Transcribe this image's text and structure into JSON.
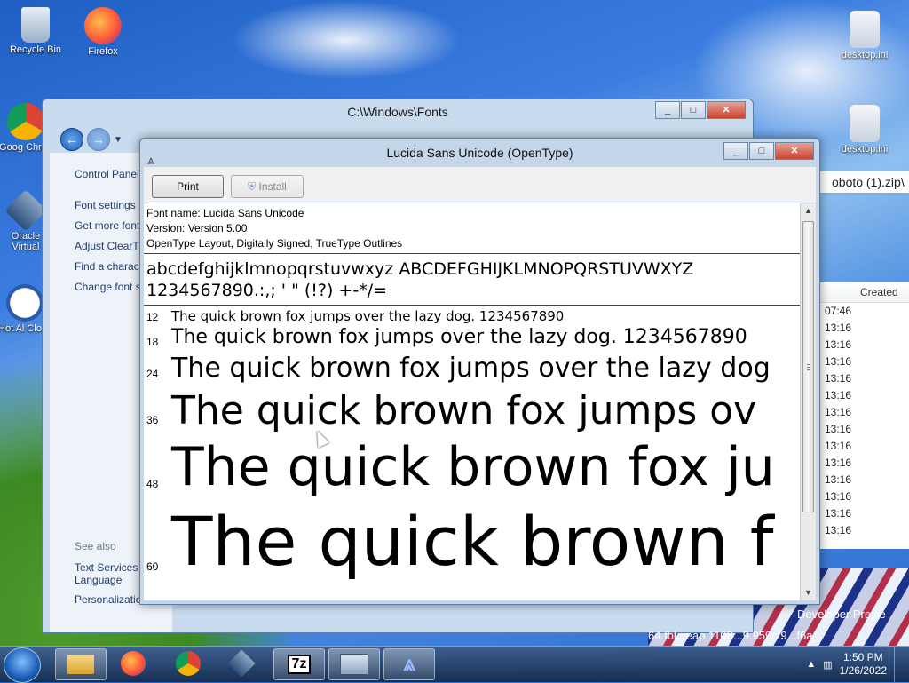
{
  "desktop": {
    "icons_left": [
      {
        "label": "Recycle Bin",
        "icon": "recycle-bin-icon"
      },
      {
        "label": "Firefox",
        "icon": "firefox-icon"
      },
      {
        "label": "Goog Chron",
        "icon": "chrome-icon"
      },
      {
        "label": "Oracle Virtual",
        "icon": "virtualbox-icon"
      },
      {
        "label": "Hot Al Clock",
        "icon": "clock-icon"
      }
    ],
    "icons_right": [
      {
        "label": "desktop.ini",
        "icon": "settings-file-icon"
      },
      {
        "label": "desktop.ini",
        "icon": "settings-file-icon"
      }
    ]
  },
  "explorer": {
    "title": "C:\\Windows\\Fonts",
    "left_links": [
      "Control Panel",
      "Font settings",
      "Get more font online",
      "Adjust ClearT",
      "Find a characte",
      "Change font s"
    ],
    "see_also_label": "See also",
    "see_also_links": [
      "Text Services Language",
      "Personalizatio"
    ],
    "address_right": "oboto (1).zip\\",
    "column_header": "Created",
    "created_times": [
      "07:46",
      "13:16",
      "13:16",
      "13:16",
      "13:16",
      "13:16",
      "13:16",
      "13:16",
      "13:16",
      "13:16",
      "13:16",
      "13:16",
      "13:16",
      "13:16"
    ],
    "status_lines": [
      "Developer Previe",
      "64.fbl...eap.1108...9.959cf9...f6a"
    ],
    "hidden_button": "Flag"
  },
  "font_viewer": {
    "title": "Lucida Sans Unicode (OpenType)",
    "print_button": "Print",
    "install_button": "Install",
    "font_name_line": "Font name: Lucida Sans Unicode",
    "version_line": "Version: Version 5.00",
    "features_line": "OpenType Layout, Digitally Signed, TrueType Outlines",
    "charset_line1": "abcdefghijklmnopqrstuvwxyz ABCDEFGHIJKLMNOPQRSTUVWXYZ",
    "charset_line2": "1234567890.:,; ' \" (!?) +-*/=",
    "samples": [
      {
        "size": "12",
        "text": "The quick brown fox jumps over the lazy dog. 1234567890"
      },
      {
        "size": "18",
        "text": "The quick brown fox jumps over the lazy dog. 1234567890"
      },
      {
        "size": "24",
        "text": "The quick brown fox jumps over the lazy dog"
      },
      {
        "size": "36",
        "text": "The quick brown fox jumps ov"
      },
      {
        "size": "48",
        "text": "The quick brown fox ju"
      },
      {
        "size": "60",
        "text": "The quick brown f"
      }
    ]
  },
  "taskbar": {
    "items": [
      {
        "label": "",
        "icon": "explorer-icon"
      },
      {
        "label": "",
        "icon": "firefox-icon"
      },
      {
        "label": "",
        "icon": "chrome-icon"
      },
      {
        "label": "",
        "icon": "virtualbox-icon"
      },
      {
        "label": "7z",
        "icon": "7zip-icon"
      },
      {
        "label": "",
        "icon": "control-panel-icon"
      },
      {
        "label": "",
        "icon": "font-viewer-icon"
      }
    ],
    "time": "1:50 PM",
    "date": "1/26/2022"
  },
  "colors": {
    "titlebar": "#c4d6ea",
    "close_button": "#c8452e",
    "accent": "#1c5fb8"
  }
}
